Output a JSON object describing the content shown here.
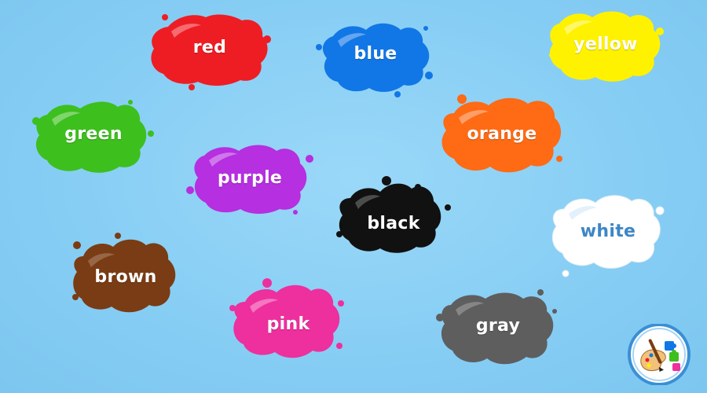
{
  "palette": {
    "red": "#ee1d24",
    "blue": "#1177e6",
    "yellow": "#fff200",
    "green": "#3dbf1e",
    "orange": "#ff6a14",
    "purple": "#b62fe0",
    "black": "#111111",
    "white": "#ffffff",
    "brown": "#7a3c14",
    "pink": "#ee2f9e",
    "gray": "#5e5e5e",
    "background": "#86cdf4",
    "white_label_text": "#3d86c6"
  },
  "splats": [
    {
      "name": "red",
      "label": "red",
      "color_key": "red"
    },
    {
      "name": "blue",
      "label": "blue",
      "color_key": "blue"
    },
    {
      "name": "yellow",
      "label": "yellow",
      "color_key": "yellow"
    },
    {
      "name": "green",
      "label": "green",
      "color_key": "green"
    },
    {
      "name": "orange",
      "label": "orange",
      "color_key": "orange"
    },
    {
      "name": "purple",
      "label": "purple",
      "color_key": "purple"
    },
    {
      "name": "black",
      "label": "black",
      "color_key": "black"
    },
    {
      "name": "white",
      "label": "white",
      "color_key": "white"
    },
    {
      "name": "brown",
      "label": "brown",
      "color_key": "brown"
    },
    {
      "name": "pink",
      "label": "pink",
      "color_key": "pink"
    },
    {
      "name": "gray",
      "label": "gray",
      "color_key": "gray"
    }
  ],
  "logo": {
    "icon": "art-palette-puzzle-icon"
  }
}
